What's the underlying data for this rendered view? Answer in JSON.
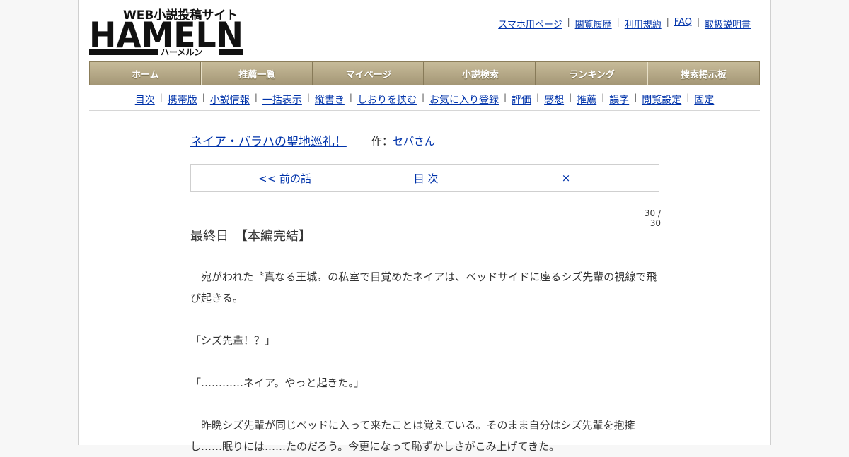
{
  "logo": {
    "tagline": "WEB小説投稿サイト",
    "name": "HAMELN",
    "kana": "ハーメルン"
  },
  "toplinks": [
    "スマホ用ページ",
    "閲覧履歴",
    "利用規約",
    "FAQ",
    "取扱説明書"
  ],
  "mainnav": [
    "ホーム",
    "推薦一覧",
    "マイページ",
    "小説検索",
    "ランキング",
    "捜索掲示板"
  ],
  "subnav": [
    "目次",
    "携帯版",
    "小説情報",
    "一括表示",
    "縦書き",
    "しおりを挟む",
    "お気に入り登録",
    "評価",
    "感想",
    "推薦",
    "誤字",
    "閲覧設定",
    "固定"
  ],
  "novel": {
    "title": "ネイア・バラハの聖地巡礼！",
    "author_label": "作：",
    "author": "セパさん",
    "prev": "<< 前の話",
    "toc": "目 次",
    "next": "×",
    "page_count": "30 / 30",
    "chapter_title": "最終日　【本編完結】",
    "paragraphs": [
      "　宛がわれた〝真なる王城〟の私室で目覚めたネイアは、ベッドサイドに座るシズ先輩の視線で飛び起きる。",
      "",
      "「シズ先輩！？」",
      "",
      "「…………ネイア。やっと起きた。」",
      "",
      "　昨晩シズ先輩が同じベッドに入って来たことは覚えている。そのまま自分はシズ先輩を抱擁し……眠りには……たのだろう。今更になって恥ずかしさがこみ上げてきた。"
    ]
  }
}
